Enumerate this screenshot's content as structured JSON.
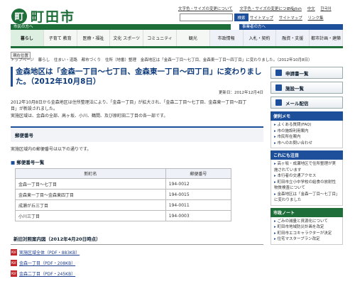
{
  "header": {
    "logo_mark": "町",
    "logo_text": "町田市",
    "links": [
      "文字色・サイズの変更について",
      "文字色・サイズの変更について"
    ],
    "langs": [
      "English",
      "中文",
      "한국어"
    ],
    "search_button": "検索",
    "util": [
      "サイトマップ",
      "サイトマップ",
      "リンク集"
    ]
  },
  "bars": {
    "left": "市民の方へ",
    "right": "事業者の方へ"
  },
  "nav": [
    {
      "label": "暮らし"
    },
    {
      "label": "子育て 教育"
    },
    {
      "label": "医療・福祉"
    },
    {
      "label": "文化 スポーツ"
    },
    {
      "label": "コミュニティ"
    },
    {
      "label": "観光"
    },
    {
      "label": "市政情報"
    },
    {
      "label": "入札・契約"
    },
    {
      "label": "融資・支援"
    },
    {
      "label": "都市計画・建築"
    }
  ],
  "crumb_tag": "現在位置",
  "breadcrumbs": [
    "トップページ",
    "暮らし",
    "住まい・道路",
    "都市づくり",
    "住所（地番）整理",
    "金森地区は「金森一丁目～七丁目、金森東一丁目～四丁目」に変わりました。（2012年10月8日）"
  ],
  "main": {
    "title": "金森地区は「金森一丁目～七丁目、金森東一丁目～四丁目」に変わりました。（2012年10月8日）",
    "updated": "更新日：2012年12月4日",
    "para1": "2012年10月8日から金森地区は住所整理法により、「金森一丁目」が拡大され、「金森二丁目～七丁目、金森東一丁目～四丁目」が新設されました。",
    "para2": "実施区域は、金森の全部、高ヶ坂、小川、鶴間、及び原町田二丁目の各一部です。",
    "section1": "郵便番号",
    "section1_text": "実施区域内の郵便番号は以下の通りです。",
    "table_title": "郵便番号一覧",
    "table": {
      "headers": [
        "新町名",
        "郵便番号"
      ],
      "rows": [
        [
          "金森一丁目～七丁目",
          "194-0012"
        ],
        [
          "金森東一丁目～金森東四丁目",
          "194-0015"
        ],
        [
          "成瀬が丘三丁目",
          "194-0011"
        ],
        [
          "小川三丁目",
          "194-0003"
        ]
      ]
    },
    "section2": "新旧対照案内図（2012年4月20日時点）",
    "pdfs": [
      "実施区域全体（PDF・883KB）",
      "金森一丁目（PDF・208KB）",
      "金森二丁目（PDF・245KB）"
    ]
  },
  "side": {
    "buttons": [
      "申請書一覧",
      "施設一覧",
      "メール配信"
    ],
    "box1": {
      "title": "便利メモ",
      "items": [
        "よくある質問(FAQ)",
        "市の施設利用案内",
        "市民所在案内",
        "市へのお問い合わせ"
      ]
    },
    "box2": {
      "title": "これにも注目",
      "items": [
        "高ヶ坂・成瀬地区で住所整理が実施されています",
        "本行者の交通アクセス",
        "町田市立小中学校の給食の放射性物質検査について",
        "金森地区は「金森一丁目～七丁目」に変わりました"
      ]
    },
    "box3": {
      "title": "市政ノート",
      "items": [
        "ごみの減量と資源化について",
        "町田市地域防災計画を改定",
        "町田市エコキャラクターが決定",
        "住宅マスタープラン改定"
      ]
    }
  }
}
